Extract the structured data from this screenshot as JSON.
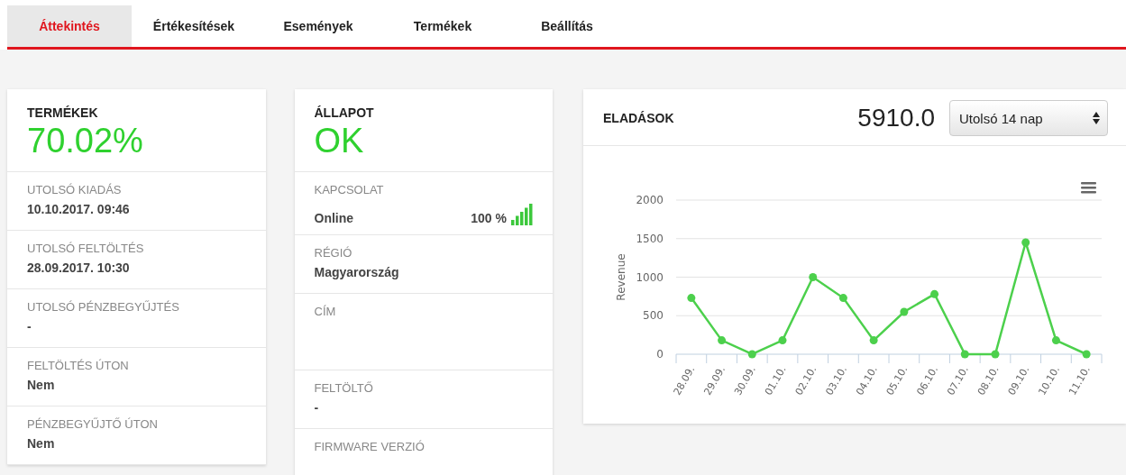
{
  "tabs": [
    {
      "label": "Áttekintés",
      "selected": true
    },
    {
      "label": "Értékesítések",
      "selected": false
    },
    {
      "label": "Események",
      "selected": false
    },
    {
      "label": "Termékek",
      "selected": false
    },
    {
      "label": "Beállítás",
      "selected": false
    }
  ],
  "products_card": {
    "title": "TERMÉKEK",
    "value": "70.02%",
    "rows": [
      {
        "label": "UTOLSÓ KIADÁS",
        "value": "10.10.2017. 09:46"
      },
      {
        "label": "UTOLSÓ FELTÖLTÉS",
        "value": "28.09.2017. 10:30"
      },
      {
        "label": "UTOLSÓ PÉNZBEGYŰJTÉS",
        "value": "-"
      },
      {
        "label": "FELTÖLTÉS ÚTON",
        "value": "Nem"
      },
      {
        "label": "PÉNZBEGYŰJTŐ ÚTON",
        "value": "Nem"
      }
    ]
  },
  "status_card": {
    "title": "ÁLLAPOT",
    "value": "OK",
    "rows": [
      {
        "label": "KAPCSOLAT",
        "value": "Online",
        "reading": "100 %"
      },
      {
        "label": "RÉGIÓ",
        "value": "Magyarország"
      },
      {
        "label": "CÍM"
      },
      {
        "label": "FELTÖLTŐ",
        "value": "-"
      },
      {
        "label": "FIRMWARE VERZIÓ"
      }
    ]
  },
  "sales_card": {
    "title": "ELADÁSOK",
    "total": "5910.0",
    "period": "Utolsó 14 nap",
    "chart_data": {
      "type": "line",
      "ylabel": "Revenue",
      "categories": [
        "28.09.",
        "29.09.",
        "30.09.",
        "01.10.",
        "02.10.",
        "03.10.",
        "04.10.",
        "05.10.",
        "06.10.",
        "07.10.",
        "08.10.",
        "09.10.",
        "10.10.",
        "11.10."
      ],
      "grid": true,
      "series": [
        {
          "color": "#4cd04c",
          "marker": true,
          "values": [
            730,
            180,
            0,
            180,
            1000,
            730,
            180,
            550,
            780,
            0,
            0,
            1450,
            180,
            0
          ]
        }
      ],
      "ylim": [
        0,
        2000
      ],
      "yticks": [
        0,
        500,
        1000,
        1500,
        2000
      ]
    }
  }
}
